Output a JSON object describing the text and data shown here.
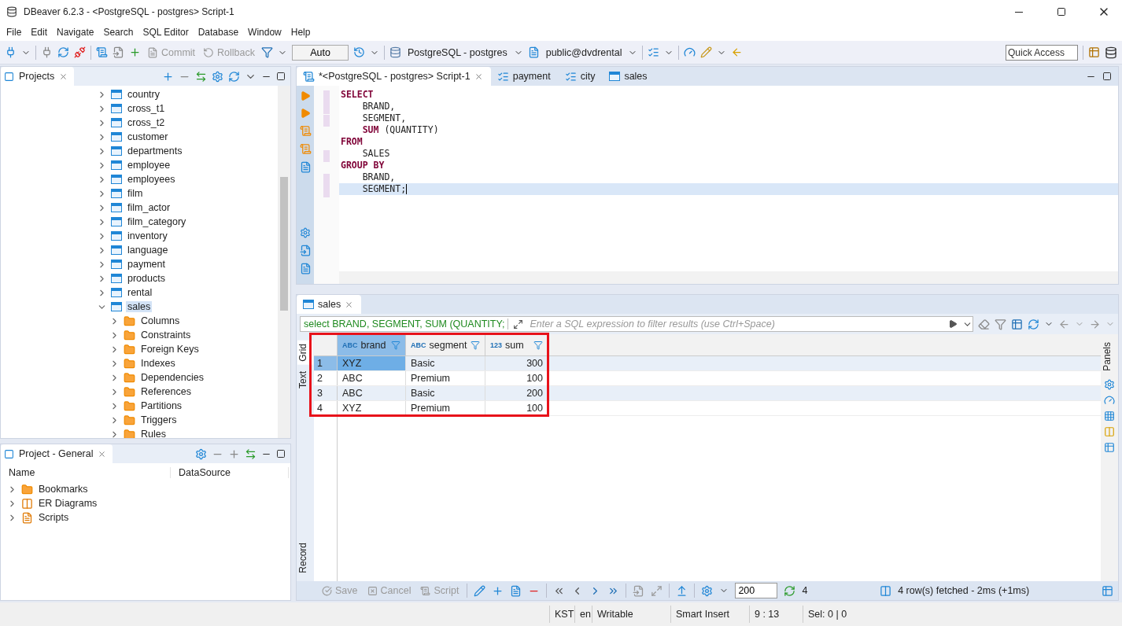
{
  "window": {
    "title": "DBeaver 6.2.3 - <PostgreSQL - postgres> Script-1"
  },
  "menu": [
    "File",
    "Edit",
    "Navigate",
    "Search",
    "SQL Editor",
    "Database",
    "Window",
    "Help"
  ],
  "toolbar": {
    "commit": {
      "label": "Commit",
      "disabled": true
    },
    "rollback": {
      "label": "Rollback",
      "disabled": true
    },
    "mode": "Auto",
    "connection": "PostgreSQL - postgres",
    "schema": "public@dvdrental",
    "quick_access": "Quick Access"
  },
  "projects": {
    "title": "Projects",
    "items": [
      {
        "label": "country",
        "kind": "table",
        "expanded": false,
        "selected": false
      },
      {
        "label": "cross_t1",
        "kind": "table",
        "expanded": false,
        "selected": false
      },
      {
        "label": "cross_t2",
        "kind": "table",
        "expanded": false,
        "selected": false
      },
      {
        "label": "customer",
        "kind": "table",
        "expanded": false,
        "selected": false
      },
      {
        "label": "departments",
        "kind": "table",
        "expanded": false,
        "selected": false
      },
      {
        "label": "employee",
        "kind": "table",
        "expanded": false,
        "selected": false
      },
      {
        "label": "employees",
        "kind": "table",
        "expanded": false,
        "selected": false
      },
      {
        "label": "film",
        "kind": "table",
        "expanded": false,
        "selected": false
      },
      {
        "label": "film_actor",
        "kind": "table",
        "expanded": false,
        "selected": false
      },
      {
        "label": "film_category",
        "kind": "table",
        "expanded": false,
        "selected": false
      },
      {
        "label": "inventory",
        "kind": "table",
        "expanded": false,
        "selected": false
      },
      {
        "label": "language",
        "kind": "table",
        "expanded": false,
        "selected": false
      },
      {
        "label": "payment",
        "kind": "table",
        "expanded": false,
        "selected": false
      },
      {
        "label": "products",
        "kind": "table",
        "expanded": false,
        "selected": false
      },
      {
        "label": "rental",
        "kind": "table",
        "expanded": false,
        "selected": false
      },
      {
        "label": "sales",
        "kind": "table",
        "expanded": true,
        "selected": true,
        "children": [
          {
            "label": "Columns",
            "kind": "folder",
            "expanded": false,
            "selected": false
          },
          {
            "label": "Constraints",
            "kind": "folder",
            "expanded": false,
            "selected": false
          },
          {
            "label": "Foreign Keys",
            "kind": "folder",
            "expanded": false,
            "selected": false
          },
          {
            "label": "Indexes",
            "kind": "folder",
            "expanded": false,
            "selected": false
          },
          {
            "label": "Dependencies",
            "kind": "folder",
            "expanded": false,
            "selected": false
          },
          {
            "label": "References",
            "kind": "folder",
            "expanded": false,
            "selected": false
          },
          {
            "label": "Partitions",
            "kind": "folder",
            "expanded": false,
            "selected": false
          },
          {
            "label": "Triggers",
            "kind": "folder",
            "expanded": false,
            "selected": false
          },
          {
            "label": "Rules",
            "kind": "folder",
            "expanded": false,
            "selected": false
          }
        ]
      }
    ]
  },
  "project_general": {
    "title": "Project - General",
    "columns": [
      "Name",
      "DataSource"
    ],
    "items": [
      {
        "label": "Bookmarks",
        "kind": "bookmarks"
      },
      {
        "label": "ER Diagrams",
        "kind": "diagrams"
      },
      {
        "label": "Scripts",
        "kind": "scripts"
      }
    ]
  },
  "editor": {
    "tabs": [
      {
        "label": "*<PostgreSQL - postgres> Script-1",
        "kind": "script",
        "selected": true
      },
      {
        "label": "payment",
        "kind": "query",
        "selected": false
      },
      {
        "label": "city",
        "kind": "query",
        "selected": false
      },
      {
        "label": "sales",
        "kind": "table",
        "selected": false
      }
    ],
    "lines": [
      {
        "tokens": [
          {
            "text": "SELECT",
            "kind": "keyword"
          }
        ],
        "current": false
      },
      {
        "tokens": [
          {
            "text": "    BRAND,",
            "kind": "plain"
          }
        ],
        "current": false
      },
      {
        "tokens": [
          {
            "text": "    SEGMENT,",
            "kind": "plain"
          }
        ],
        "current": false
      },
      {
        "tokens": [
          {
            "text": "    SUM",
            "kind": "keyword"
          },
          {
            "text": " (QUANTITY)",
            "kind": "plain"
          }
        ],
        "current": false
      },
      {
        "tokens": [
          {
            "text": "FROM",
            "kind": "keyword"
          }
        ],
        "current": false
      },
      {
        "tokens": [
          {
            "text": "    SALES",
            "kind": "plain"
          }
        ],
        "current": false
      },
      {
        "tokens": [
          {
            "text": "GROUP BY",
            "kind": "keyword"
          }
        ],
        "current": false
      },
      {
        "tokens": [
          {
            "text": "    BRAND,",
            "kind": "plain"
          }
        ],
        "current": false
      },
      {
        "tokens": [
          {
            "text": "    SEGMENT;",
            "kind": "plain"
          }
        ],
        "current": true
      }
    ]
  },
  "results": {
    "tab": "sales",
    "query": "select BRAND, SEGMENT, SUM (QUANTITY;",
    "filter_placeholder": "Enter a SQL expression to filter results (use Ctrl+Space)",
    "side_tabs": [
      {
        "label": "Grid",
        "selected": true
      },
      {
        "label": "Text",
        "selected": false
      },
      {
        "label": "Record",
        "selected": false
      }
    ],
    "highlighted": true,
    "columns": [
      {
        "label": "brand",
        "type": "ABC"
      },
      {
        "label": "segment",
        "type": "ABC"
      },
      {
        "label": "sum",
        "type": "123"
      }
    ],
    "rows": [
      {
        "number": "1",
        "cells": [
          "XYZ",
          "Basic",
          "300"
        ],
        "selected": true
      },
      {
        "number": "2",
        "cells": [
          "ABC",
          "Premium",
          "100"
        ],
        "selected": false
      },
      {
        "number": "3",
        "cells": [
          "ABC",
          "Basic",
          "200"
        ],
        "selected": false
      },
      {
        "number": "4",
        "cells": [
          "XYZ",
          "Premium",
          "100"
        ],
        "selected": false
      }
    ],
    "panels_label": "Panels",
    "bottom": {
      "save": {
        "label": "Save",
        "disabled": true
      },
      "cancel": {
        "label": "Cancel",
        "disabled": true
      },
      "script": {
        "label": "Script",
        "disabled": true
      },
      "fetch_size": "200",
      "row_count": "4",
      "status": "4 row(s) fetched - 2ms (+1ms)"
    }
  },
  "status_bar": [
    "KST",
    "en",
    "Writable",
    "Smart Insert",
    "9 : 13",
    "Sel: 0 | 0"
  ]
}
